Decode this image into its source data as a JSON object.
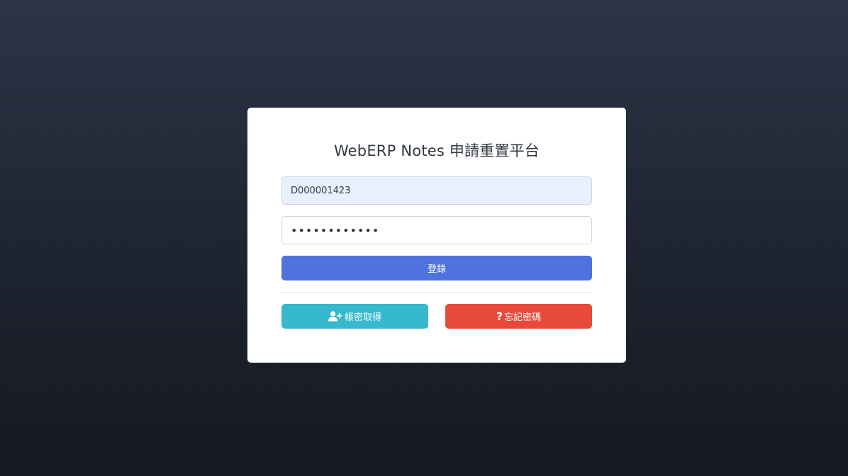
{
  "form": {
    "title": "WebERP Notes 申請重置平台",
    "username_value": "D000001423",
    "password_value": "************",
    "login_label": "登錄",
    "register_label": "帳密取得",
    "forgot_label": "忘記密碼",
    "register_icon": "user-plus-icon",
    "forgot_icon": "question-icon"
  },
  "colors": {
    "login_button": "#4e73df",
    "register_button": "#36b9cc",
    "forgot_button": "#e74a3b",
    "autofill_field": "#e8f0fe"
  }
}
